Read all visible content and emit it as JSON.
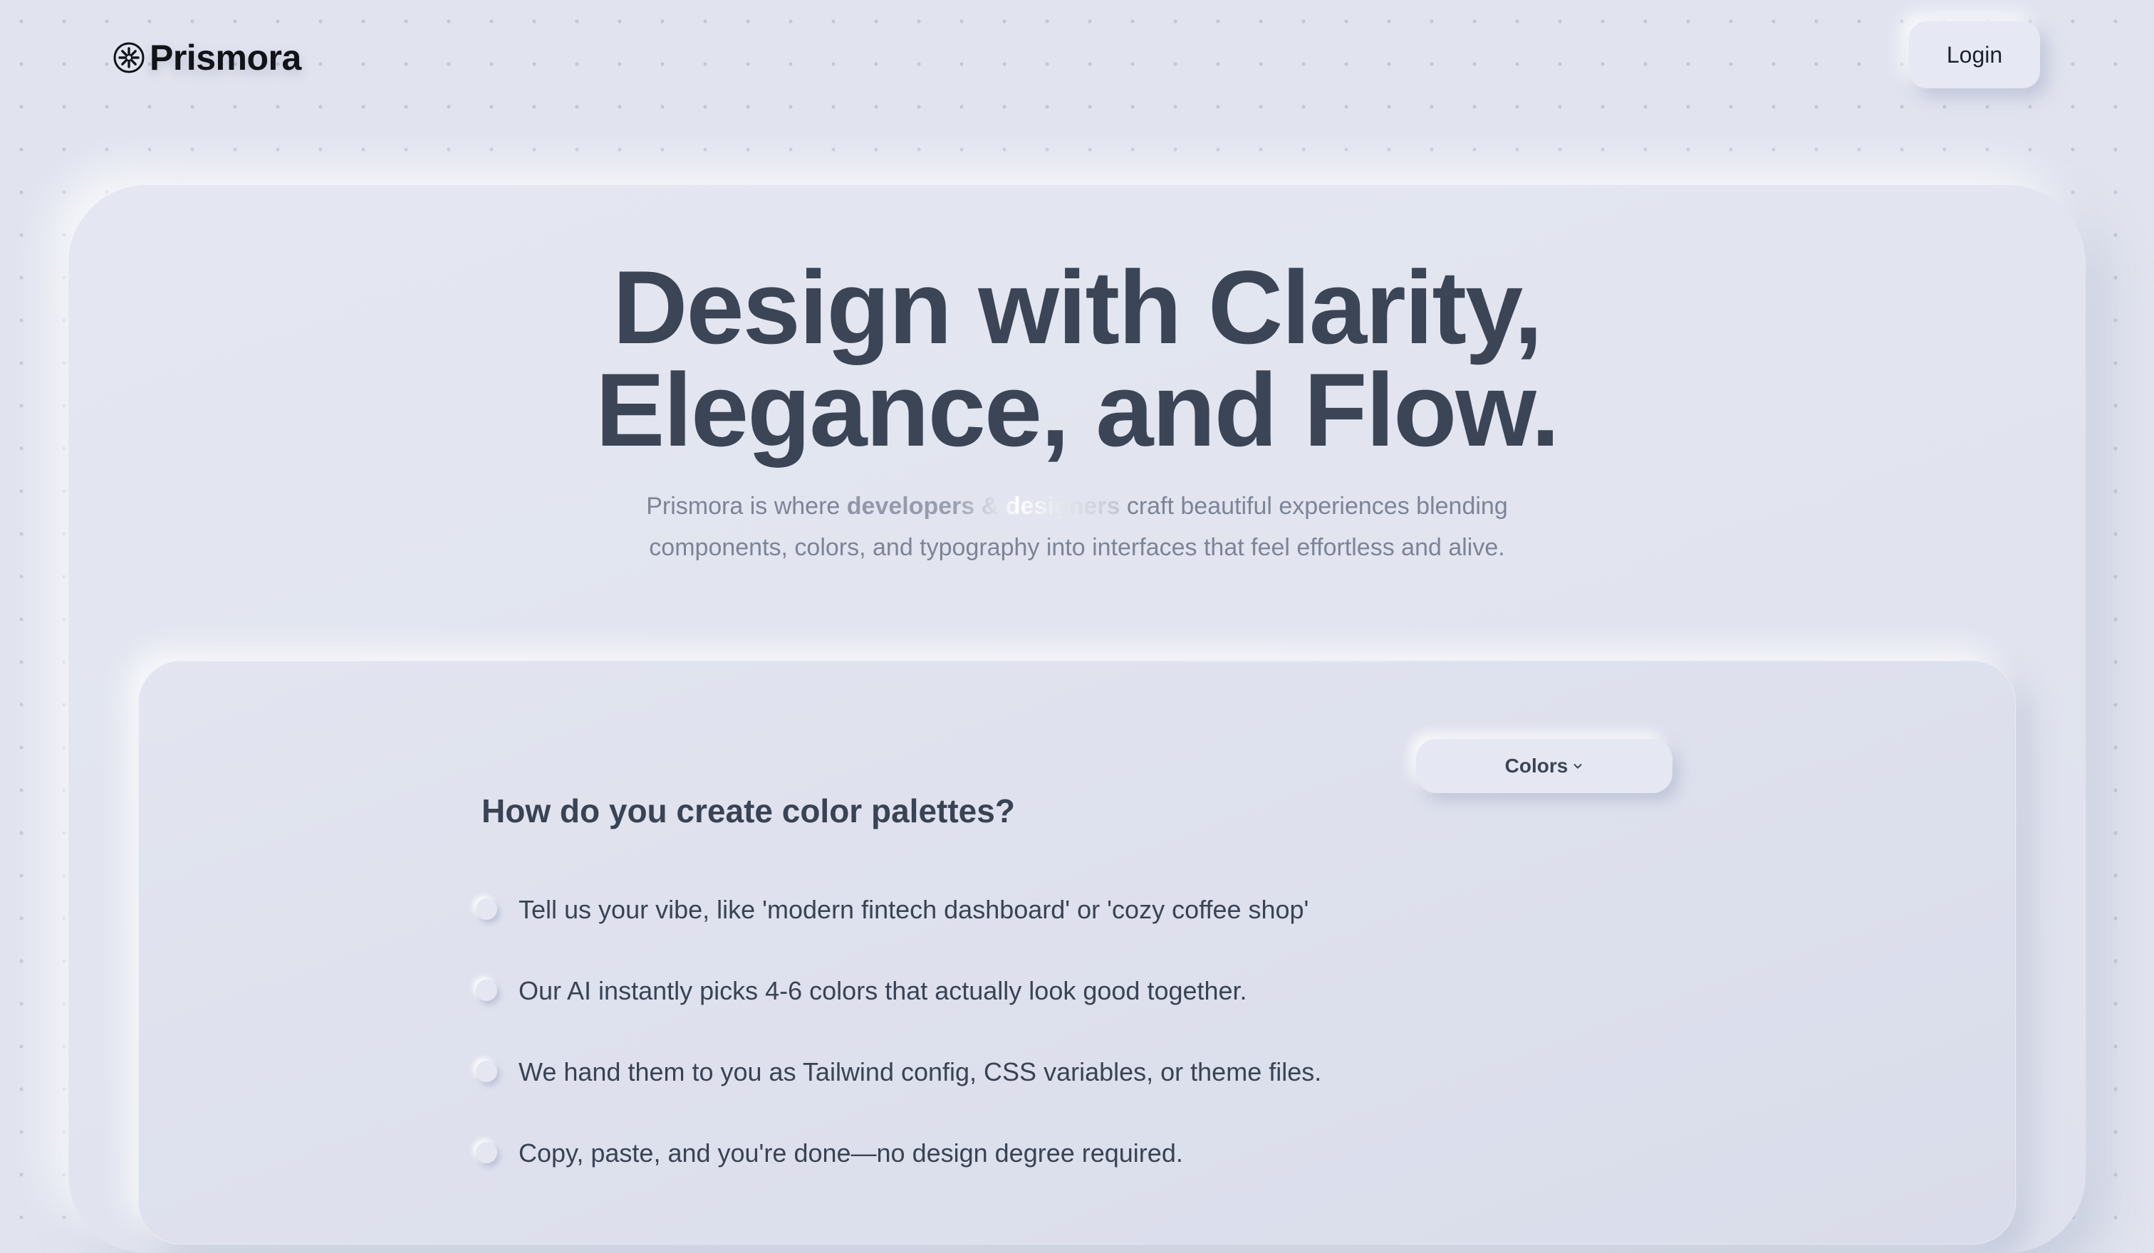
{
  "header": {
    "brand": "Prismora",
    "logo_icon": "asterisk-circle-icon",
    "login_label": "Login"
  },
  "hero": {
    "title_line1": "Design with Clarity,",
    "title_line2": "Elegance, and Flow.",
    "subtitle_part1": "Prismora is where ",
    "subtitle_emphasis": "developers & designers",
    "subtitle_part2": " craft beautiful experiences blending",
    "subtitle_line2": "components, colors, and typography into interfaces that feel effortless and alive."
  },
  "demo": {
    "category_label": "Colors",
    "category_icon": "chevron-down-icon",
    "question": "How do you create color palettes?",
    "steps": [
      "Tell us your vibe, like 'modern fintech dashboard' or 'cozy coffee shop'",
      "Our AI instantly picks 4-6 colors that actually look good together.",
      "We hand them to you as Tailwind config, CSS variables, or theme files.",
      "Copy, paste, and you're done—no design degree required."
    ]
  },
  "colors": {
    "background": "#e1e4ef",
    "text_primary": "#3c4556",
    "text_muted": "#7d8496"
  }
}
